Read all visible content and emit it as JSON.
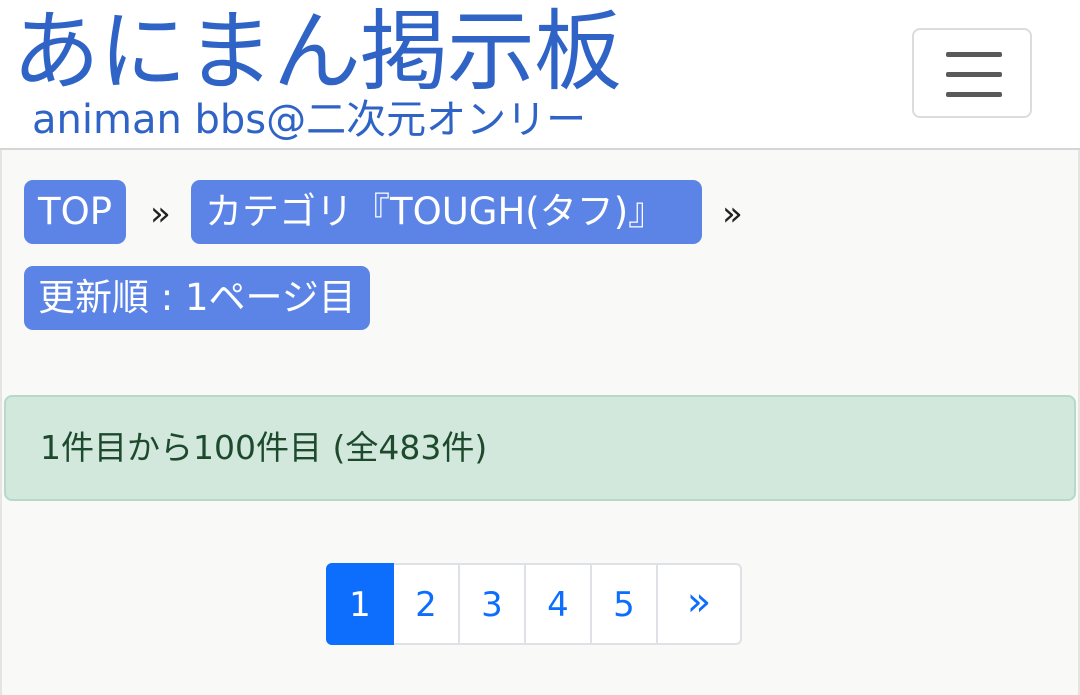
{
  "header": {
    "site_title": "あにまん掲示板",
    "site_subtitle": "animan bbs@二次元オンリー",
    "menu_icon": "hamburger-icon"
  },
  "breadcrumb": {
    "items": [
      {
        "label": "TOP"
      },
      {
        "label": "カテゴリ『TOUGH(タフ)』"
      },
      {
        "label": "更新順 : 1ページ目"
      }
    ],
    "separator": "»"
  },
  "alert": {
    "text": "1件目から100件目 (全483件)"
  },
  "pagination": {
    "pages": [
      "1",
      "2",
      "3",
      "4",
      "5"
    ],
    "current": "1",
    "next_label": "»"
  },
  "colors": {
    "brand": "#2f64c6",
    "breadcrumb_bg": "#5b84e6",
    "alert_bg": "#d2e8dd",
    "alert_text": "#1d4a2d",
    "active_page": "#0d6efd"
  }
}
